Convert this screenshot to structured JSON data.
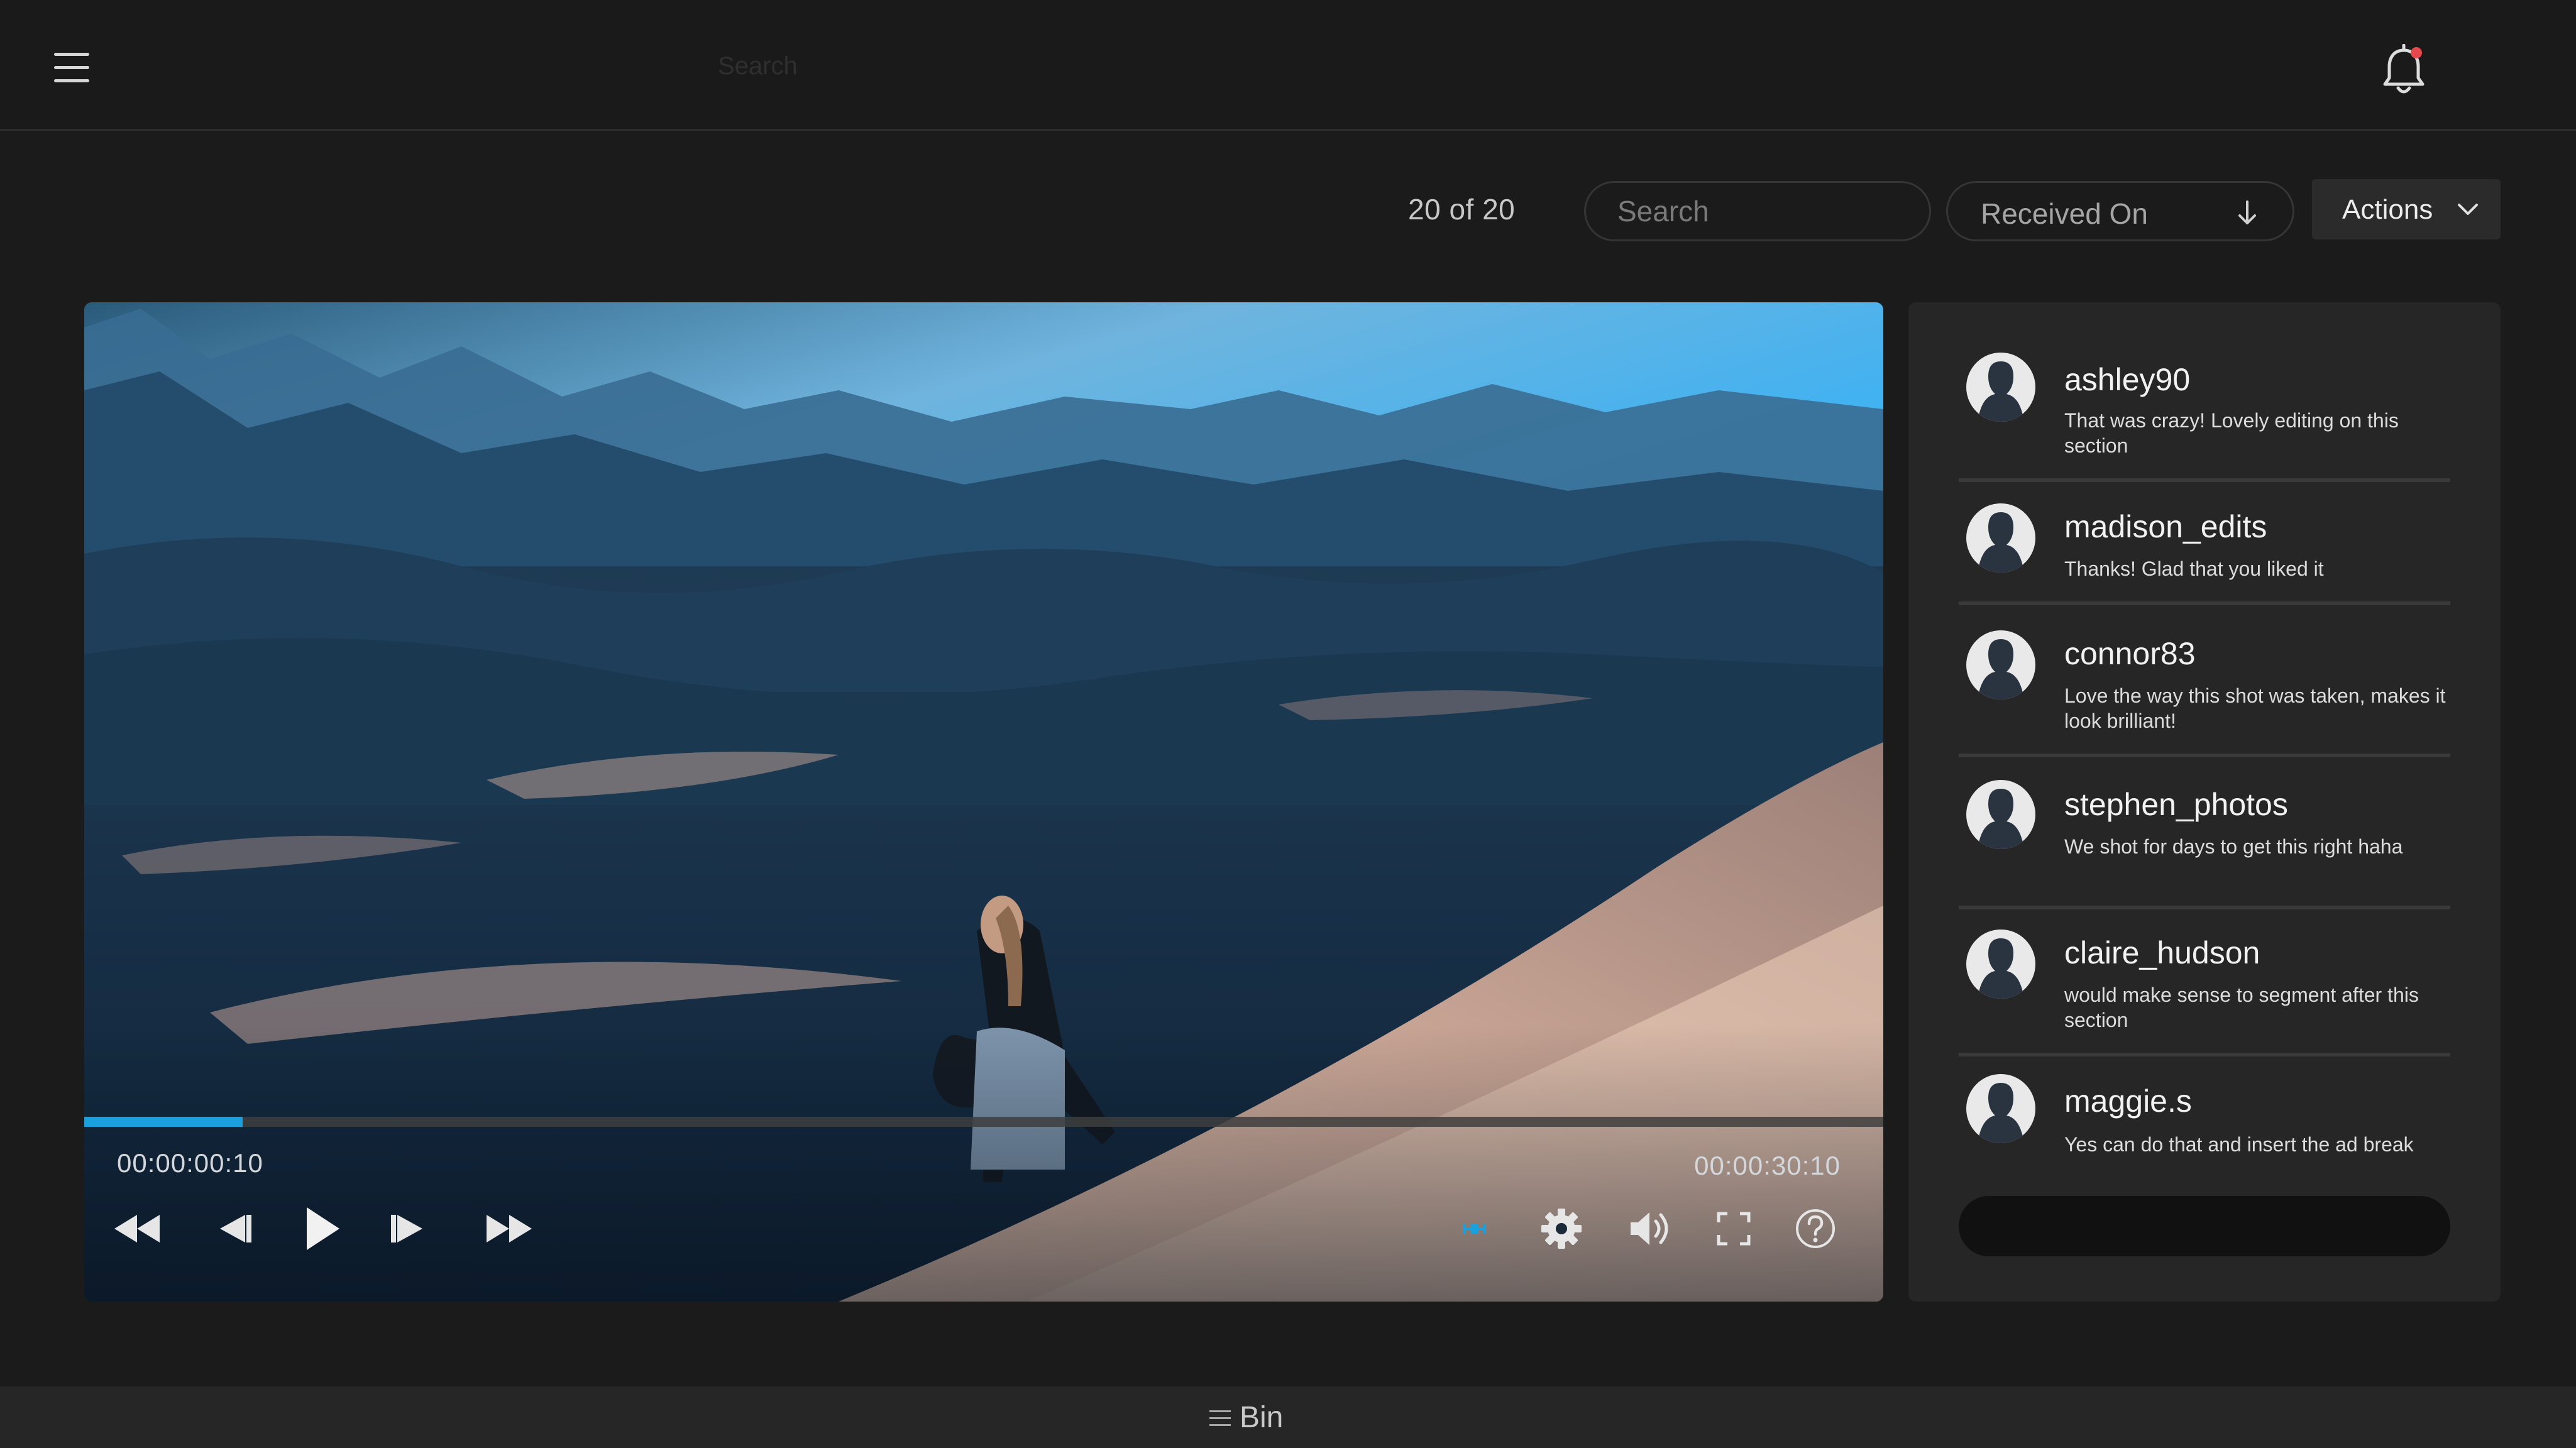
{
  "header": {
    "menu_icon": "hamburger-menu-icon",
    "search_placeholder": "Search",
    "notification_icon": "bell-icon",
    "notification_dot_color": "#e5484d"
  },
  "toolbar": {
    "count_label": "20 of 20",
    "search_placeholder": "Search",
    "sort_label": "Received On",
    "sort_icon": "arrow-down-icon",
    "actions_label": "Actions",
    "actions_icon": "chevron-down-icon"
  },
  "player": {
    "current_time": "00:00:00:10",
    "total_time": "00:00:30:10",
    "progress_fraction": 0.088,
    "accent_color": "#1aa0dc",
    "controls": [
      "rewind-icon",
      "step-back-icon",
      "play-icon",
      "step-forward-icon",
      "fast-forward-icon",
      "pin-icon",
      "settings-gear-icon",
      "volume-icon",
      "fullscreen-icon",
      "help-icon"
    ]
  },
  "comments": [
    {
      "user": "ashley90",
      "text": "That was crazy! Lovely editing on this section"
    },
    {
      "user": "madison_edits",
      "text": "Thanks! Glad that you liked it"
    },
    {
      "user": "connor83",
      "text": "Love the way this shot was taken, makes it look brilliant!"
    },
    {
      "user": "stephen_photos",
      "text": "We shot for days to get this right haha"
    },
    {
      "user": "claire_hudson",
      "text": "would make sense to segment after this section"
    },
    {
      "user": "maggie.s",
      "text": "Yes can do that and insert the ad break"
    }
  ],
  "bin": {
    "label": "Bin",
    "icon": "list-icon"
  }
}
